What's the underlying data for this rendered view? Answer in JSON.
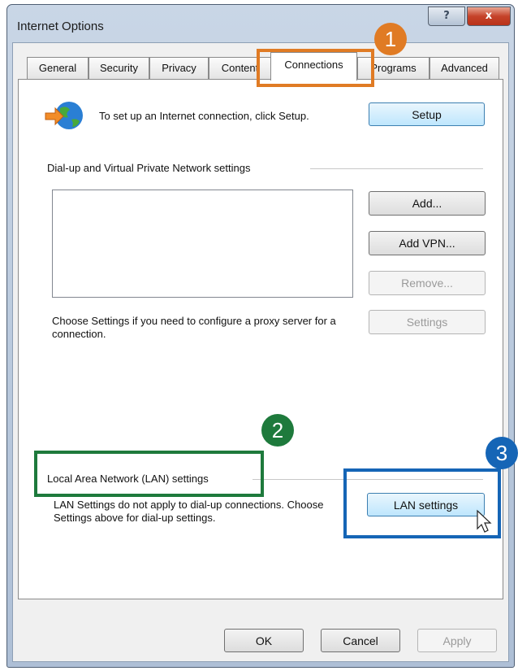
{
  "window": {
    "title": "Internet Options",
    "help_label": "?",
    "close_label": "x"
  },
  "tabs": [
    "General",
    "Security",
    "Privacy",
    "Content",
    "Connections",
    "Programs",
    "Advanced"
  ],
  "active_tab": "Connections",
  "setup": {
    "text": "To set up an Internet connection, click Setup.",
    "button": "Setup"
  },
  "dialup": {
    "section_label": "Dial-up and Virtual Private Network settings",
    "add_button": "Add...",
    "add_vpn_button": "Add VPN...",
    "remove_button": "Remove...",
    "settings_button": "Settings",
    "proxy_text": "Choose Settings if you need to configure a proxy server for a connection."
  },
  "lan": {
    "section_label": "Local Area Network (LAN) settings",
    "text": "LAN Settings do not apply to dial-up connections. Choose Settings above for dial-up settings.",
    "button": "LAN settings"
  },
  "footer": {
    "ok": "OK",
    "cancel": "Cancel",
    "apply": "Apply"
  },
  "annotations": [
    {
      "number": "1",
      "color": "#e07b24"
    },
    {
      "number": "2",
      "color": "#1e7a3c"
    },
    {
      "number": "3",
      "color": "#1565b6"
    }
  ],
  "colors": {
    "orange": "#e07b24",
    "green": "#1e7a3c",
    "blue": "#1565b6"
  }
}
